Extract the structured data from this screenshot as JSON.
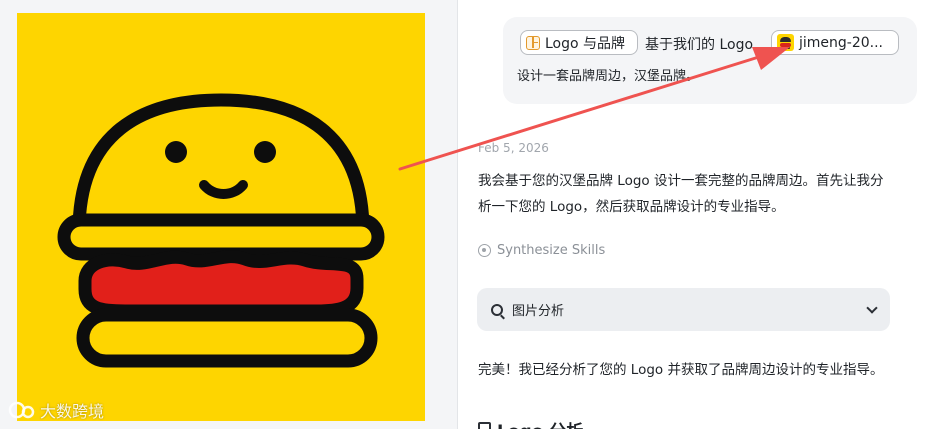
{
  "preview": {
    "image_alt": "Hamburger logo with smiling face on yellow background",
    "watermark_text": "大数跨境",
    "colors": {
      "background": "#fed500",
      "bun": "#fed500",
      "patty": "#e1201a",
      "outline": "#0d0d0d"
    }
  },
  "user_message": {
    "chip_logo_label": "Logo 与品牌",
    "text_part1": "基于我们的 Logo",
    "chip_file_label": "jimeng-20...",
    "text_part2": "设计一套品牌周边，汉堡品牌。"
  },
  "assistant": {
    "date": "Feb 5, 2026",
    "intro": "我会基于您的汉堡品牌 Logo 设计一套完整的品牌周边。首先让我分析一下您的 Logo，然后获取品牌设计的专业指导。",
    "skill_label": "Synthesize Skills",
    "dropdown_label": "图片分析",
    "followup": "完美！我已经分析了您的 Logo 并获取了品牌周边设计的专业指导。",
    "heading": "Logo 分析"
  },
  "annotation": {
    "arrow_color": "#ef5350"
  },
  "icons": [
    "grid-icon",
    "image-thumb-icon",
    "skill-icon",
    "image-analysis-icon",
    "chevron-down-icon",
    "clipboard-icon",
    "watermark-logo-icon"
  ]
}
